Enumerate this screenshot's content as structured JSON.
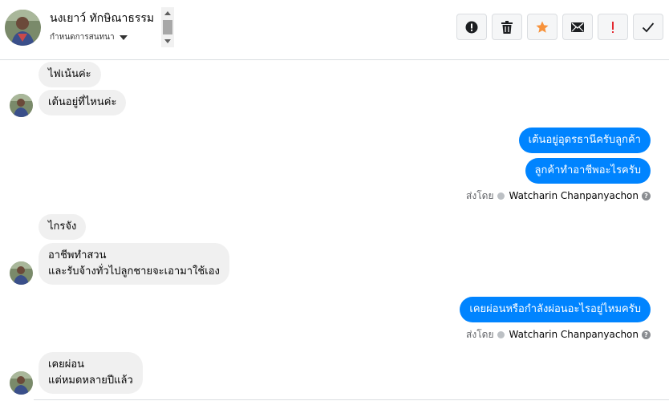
{
  "header": {
    "contact_name": "นงเยาว์ ทักษิณาธรรม",
    "subtitle": "กำหนดการสนทนา",
    "actions": [
      {
        "name": "spam-button",
        "icon": "alert-circle-icon"
      },
      {
        "name": "delete-button",
        "icon": "trash-icon"
      },
      {
        "name": "star-button",
        "icon": "star-icon",
        "color": "#f7923b"
      },
      {
        "name": "mark-unread-button",
        "icon": "envelope-icon"
      },
      {
        "name": "important-button",
        "icon": "exclamation-icon",
        "color": "#e4272f"
      },
      {
        "name": "done-button",
        "icon": "checkmark-icon"
      }
    ]
  },
  "messages": {
    "m1": "ไฟเน้นค่ะ",
    "m2": "เต้นอยู่ที่ไหนค่ะ",
    "m3": "เต้นอยู่อุดรธานีครับลูกค้า",
    "m4": "ลูกค้าทำอาชีพอะไรครับ",
    "sent1_prefix": "ส่งโดย",
    "sent1_name": "Watcharin Chanpanyachon",
    "m5": "ไกรจัง",
    "m6_line1": "อาชีพทำสวน",
    "m6_line2": "และรับจ้างทั่วไปลูกชายจะเอามาใช้เอง",
    "m7": "เคยผ่อนหรือกำลังผ่อนอะไรอยู่ไหมครับ",
    "sent2_prefix": "ส่งโดย",
    "sent2_name": "Watcharin Chanpanyachon",
    "m8_line1": "เคยผ่อน",
    "m8_line2": "แต่หมดหลายปีแล้ว"
  },
  "colors": {
    "outgoing_bubble": "#0084ff",
    "incoming_bubble": "#f0f0f0",
    "star": "#f7923b",
    "important": "#e4272f"
  }
}
